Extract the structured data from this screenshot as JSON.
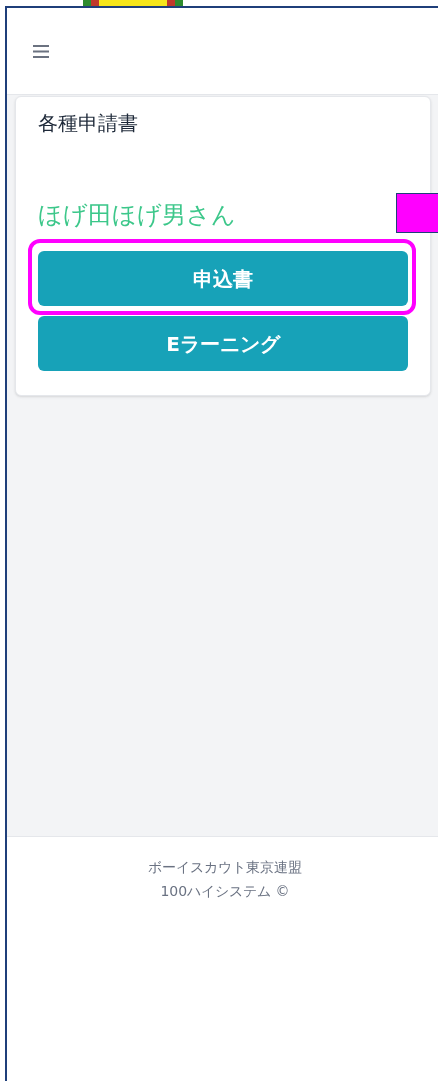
{
  "header": {
    "menu_icon": true
  },
  "card": {
    "title": "各種申請書",
    "user_name": "ほげ田ほげ男さん",
    "buttons": [
      {
        "label": "申込書",
        "highlighted": true
      },
      {
        "label": "Eラーニング",
        "highlighted": false
      }
    ]
  },
  "annotations": [
    {
      "kind": "marker"
    }
  ],
  "footer": {
    "lines": [
      "ボーイスカウト東京連盟",
      "100ハイシステム ©"
    ]
  }
}
